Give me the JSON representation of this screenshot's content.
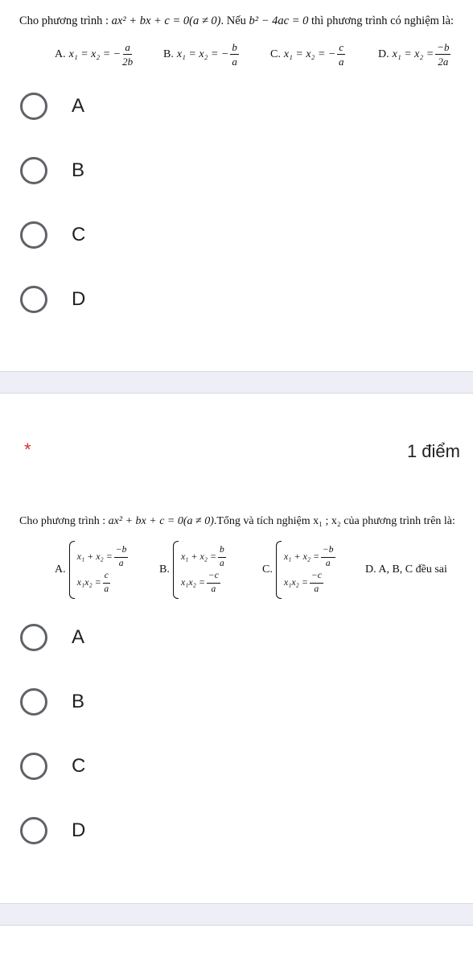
{
  "q1": {
    "prefix": "Cho phương trình : ",
    "equation": "ax² + bx + c = 0(a ≠ 0)",
    "middle": ". Nếu ",
    "condition": "b² − 4ac = 0",
    "suffix": " thì phương trình có nghiệm là:",
    "choices": [
      {
        "label": "A.",
        "lhs": "x₁ = x₂ = −",
        "num": "a",
        "den": "2b"
      },
      {
        "label": "B.",
        "lhs": "x₁ = x₂ = −",
        "num": "b",
        "den": "a"
      },
      {
        "label": "C.",
        "lhs": "x₁ = x₂ = −",
        "num": "c",
        "den": "a"
      },
      {
        "label": "D.",
        "lhs": "x₁ = x₂ =",
        "num": "−b",
        "den": "2a"
      }
    ],
    "options": [
      "A",
      "B",
      "C",
      "D"
    ]
  },
  "q2": {
    "required_mark": "*",
    "points": "1 điểm",
    "prefix": "Cho phương trình : ",
    "equation": "ax² + bx + c = 0(a ≠ 0)",
    "suffix": ".Tổng và tích nghiệm x₁ ; x₂ của phương trình trên là:",
    "choices": [
      {
        "label": "A.",
        "sum_lhs": "x₁ + x₂ =",
        "sum_num": "−b",
        "sum_den": "a",
        "prod_lhs": "x₁x₂ =",
        "prod_num": "c",
        "prod_den": "a"
      },
      {
        "label": "B.",
        "sum_lhs": "x₁ + x₂ =",
        "sum_num": "b",
        "sum_den": "a",
        "prod_lhs": "x₁x₂ =",
        "prod_num": "−c",
        "prod_den": "a"
      },
      {
        "label": "C.",
        "sum_lhs": "x₁ + x₂ =",
        "sum_num": "−b",
        "sum_den": "a",
        "prod_lhs": "x₁x₂ =",
        "prod_num": "−c",
        "prod_den": "a"
      }
    ],
    "choice_d": "D. A, B, C đều sai",
    "options": [
      "A",
      "B",
      "C",
      "D"
    ]
  }
}
